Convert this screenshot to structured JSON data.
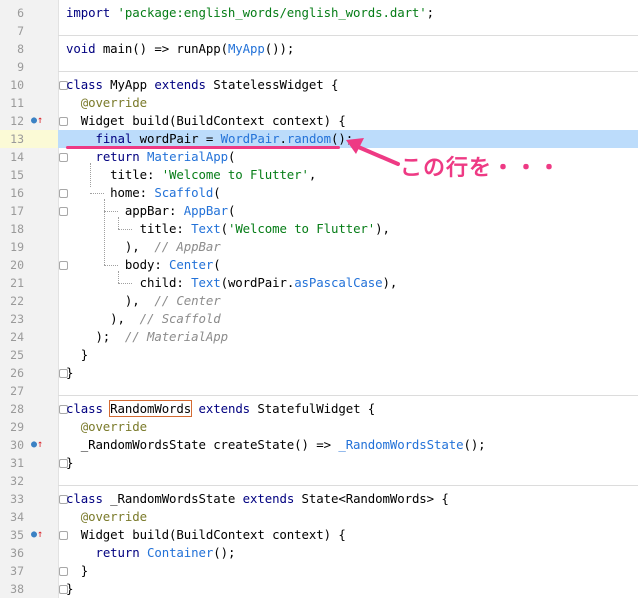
{
  "editor": {
    "lines": [
      {
        "no": "6",
        "segs": [
          {
            "t": "import ",
            "c": "kw"
          },
          {
            "t": "'package:english_words/english_words.dart'",
            "c": "str"
          },
          {
            "t": ";",
            "c": ""
          }
        ]
      },
      {
        "no": "7",
        "segs": []
      },
      {
        "no": "8",
        "segs": [
          {
            "t": "void ",
            "c": "kw"
          },
          {
            "t": "main() => runApp(",
            "c": ""
          },
          {
            "t": "MyApp",
            "c": "cls"
          },
          {
            "t": "());",
            "c": ""
          }
        ]
      },
      {
        "no": "9",
        "segs": []
      },
      {
        "no": "10",
        "segs": [
          {
            "t": "class ",
            "c": "kw"
          },
          {
            "t": "MyApp ",
            "c": ""
          },
          {
            "t": "extends ",
            "c": "kw"
          },
          {
            "t": "StatelessWidget {",
            "c": ""
          }
        ]
      },
      {
        "no": "11",
        "segs": [
          {
            "t": "  @override",
            "c": "ann"
          }
        ]
      },
      {
        "no": "12",
        "segs": [
          {
            "t": "  Widget build(BuildContext context) {",
            "c": ""
          }
        ]
      },
      {
        "no": "13",
        "segs": [
          {
            "t": "    ",
            "c": ""
          },
          {
            "t": "final ",
            "c": "kw"
          },
          {
            "t": "wordPair = ",
            "c": ""
          },
          {
            "t": "WordPair",
            "c": "cls"
          },
          {
            "t": ".",
            "c": ""
          },
          {
            "t": "random",
            "c": "cls"
          },
          {
            "t": "();",
            "c": ""
          }
        ]
      },
      {
        "no": "14",
        "segs": [
          {
            "t": "    ",
            "c": ""
          },
          {
            "t": "return ",
            "c": "kw"
          },
          {
            "t": "MaterialApp",
            "c": "cls"
          },
          {
            "t": "(",
            "c": ""
          }
        ]
      },
      {
        "no": "15",
        "segs": [
          {
            "t": "      title: ",
            "c": ""
          },
          {
            "t": "'Welcome to Flutter'",
            "c": "str"
          },
          {
            "t": ",",
            "c": ""
          }
        ]
      },
      {
        "no": "16",
        "segs": [
          {
            "t": "      home: ",
            "c": ""
          },
          {
            "t": "Scaffold",
            "c": "cls"
          },
          {
            "t": "(",
            "c": ""
          }
        ]
      },
      {
        "no": "17",
        "segs": [
          {
            "t": "        appBar: ",
            "c": ""
          },
          {
            "t": "AppBar",
            "c": "cls"
          },
          {
            "t": "(",
            "c": ""
          }
        ]
      },
      {
        "no": "18",
        "segs": [
          {
            "t": "          title: ",
            "c": ""
          },
          {
            "t": "Text",
            "c": "cls"
          },
          {
            "t": "(",
            "c": ""
          },
          {
            "t": "'Welcome to Flutter'",
            "c": "str"
          },
          {
            "t": "),",
            "c": ""
          }
        ]
      },
      {
        "no": "19",
        "segs": [
          {
            "t": "        ),  ",
            "c": ""
          },
          {
            "t": "// AppBar",
            "c": "cm"
          }
        ]
      },
      {
        "no": "20",
        "segs": [
          {
            "t": "        body: ",
            "c": ""
          },
          {
            "t": "Center",
            "c": "cls"
          },
          {
            "t": "(",
            "c": ""
          }
        ]
      },
      {
        "no": "21",
        "segs": [
          {
            "t": "          child: ",
            "c": ""
          },
          {
            "t": "Text",
            "c": "cls"
          },
          {
            "t": "(wordPair.",
            "c": ""
          },
          {
            "t": "asPascalCase",
            "c": "cls"
          },
          {
            "t": "),",
            "c": ""
          }
        ]
      },
      {
        "no": "22",
        "segs": [
          {
            "t": "        ),  ",
            "c": ""
          },
          {
            "t": "// Center",
            "c": "cm"
          }
        ]
      },
      {
        "no": "23",
        "segs": [
          {
            "t": "      ),  ",
            "c": ""
          },
          {
            "t": "// Scaffold",
            "c": "cm"
          }
        ]
      },
      {
        "no": "24",
        "segs": [
          {
            "t": "    );  ",
            "c": ""
          },
          {
            "t": "// MaterialApp",
            "c": "cm"
          }
        ]
      },
      {
        "no": "25",
        "segs": [
          {
            "t": "  }",
            "c": ""
          }
        ]
      },
      {
        "no": "26",
        "segs": [
          {
            "t": "}",
            "c": ""
          }
        ]
      },
      {
        "no": "27",
        "segs": []
      },
      {
        "no": "28",
        "segs": [
          {
            "t": "class ",
            "c": "kw"
          },
          {
            "t": "RandomWords",
            "c": "boxed"
          },
          {
            "t": " ",
            "c": ""
          },
          {
            "t": "extends ",
            "c": "kw"
          },
          {
            "t": "StatefulWidget {",
            "c": ""
          }
        ]
      },
      {
        "no": "29",
        "segs": [
          {
            "t": "  @override",
            "c": "ann"
          }
        ]
      },
      {
        "no": "30",
        "segs": [
          {
            "t": "  _RandomWordsState createState() => ",
            "c": ""
          },
          {
            "t": "_RandomWordsState",
            "c": "cls"
          },
          {
            "t": "();",
            "c": ""
          }
        ]
      },
      {
        "no": "31",
        "segs": [
          {
            "t": "}",
            "c": ""
          }
        ]
      },
      {
        "no": "32",
        "segs": []
      },
      {
        "no": "33",
        "segs": [
          {
            "t": "class ",
            "c": "kw"
          },
          {
            "t": "_RandomWordsState ",
            "c": ""
          },
          {
            "t": "extends ",
            "c": "kw"
          },
          {
            "t": "State<RandomWords> {",
            "c": ""
          }
        ]
      },
      {
        "no": "34",
        "segs": [
          {
            "t": "  @override",
            "c": "ann"
          }
        ]
      },
      {
        "no": "35",
        "segs": [
          {
            "t": "  Widget build(BuildContext context) {",
            "c": ""
          }
        ]
      },
      {
        "no": "36",
        "segs": [
          {
            "t": "    ",
            "c": ""
          },
          {
            "t": "return ",
            "c": "kw"
          },
          {
            "t": "Container",
            "c": "cls"
          },
          {
            "t": "();",
            "c": ""
          }
        ]
      },
      {
        "no": "37",
        "segs": [
          {
            "t": "  }",
            "c": ""
          }
        ]
      },
      {
        "no": "38",
        "segs": [
          {
            "t": "}",
            "c": ""
          }
        ]
      }
    ],
    "highlighted_line": "13",
    "override_markers": [
      "12",
      "30",
      "35"
    ],
    "fold_markers": [
      "10",
      "12",
      "14",
      "16",
      "17",
      "20",
      "26",
      "28",
      "31",
      "33",
      "35",
      "37",
      "38"
    ]
  },
  "callout": {
    "text": "この行を・・・",
    "color": "#ee3a84"
  },
  "colors": {
    "keyword": "#000080",
    "string": "#067d17",
    "class_ref": "#2372d8",
    "comment": "#8c8c8c",
    "highlight": "#bcdcfb",
    "gutter": "#f2f2f2"
  }
}
